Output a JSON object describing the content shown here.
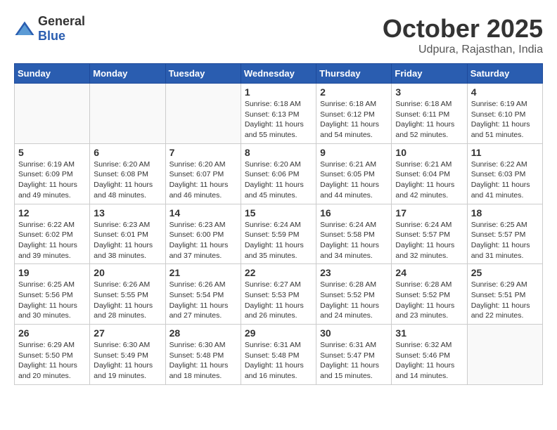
{
  "logo": {
    "general": "General",
    "blue": "Blue"
  },
  "title": "October 2025",
  "location": "Udpura, Rajasthan, India",
  "weekdays": [
    "Sunday",
    "Monday",
    "Tuesday",
    "Wednesday",
    "Thursday",
    "Friday",
    "Saturday"
  ],
  "weeks": [
    [
      {
        "day": "",
        "info": ""
      },
      {
        "day": "",
        "info": ""
      },
      {
        "day": "",
        "info": ""
      },
      {
        "day": "1",
        "info": "Sunrise: 6:18 AM\nSunset: 6:13 PM\nDaylight: 11 hours\nand 55 minutes."
      },
      {
        "day": "2",
        "info": "Sunrise: 6:18 AM\nSunset: 6:12 PM\nDaylight: 11 hours\nand 54 minutes."
      },
      {
        "day": "3",
        "info": "Sunrise: 6:18 AM\nSunset: 6:11 PM\nDaylight: 11 hours\nand 52 minutes."
      },
      {
        "day": "4",
        "info": "Sunrise: 6:19 AM\nSunset: 6:10 PM\nDaylight: 11 hours\nand 51 minutes."
      }
    ],
    [
      {
        "day": "5",
        "info": "Sunrise: 6:19 AM\nSunset: 6:09 PM\nDaylight: 11 hours\nand 49 minutes."
      },
      {
        "day": "6",
        "info": "Sunrise: 6:20 AM\nSunset: 6:08 PM\nDaylight: 11 hours\nand 48 minutes."
      },
      {
        "day": "7",
        "info": "Sunrise: 6:20 AM\nSunset: 6:07 PM\nDaylight: 11 hours\nand 46 minutes."
      },
      {
        "day": "8",
        "info": "Sunrise: 6:20 AM\nSunset: 6:06 PM\nDaylight: 11 hours\nand 45 minutes."
      },
      {
        "day": "9",
        "info": "Sunrise: 6:21 AM\nSunset: 6:05 PM\nDaylight: 11 hours\nand 44 minutes."
      },
      {
        "day": "10",
        "info": "Sunrise: 6:21 AM\nSunset: 6:04 PM\nDaylight: 11 hours\nand 42 minutes."
      },
      {
        "day": "11",
        "info": "Sunrise: 6:22 AM\nSunset: 6:03 PM\nDaylight: 11 hours\nand 41 minutes."
      }
    ],
    [
      {
        "day": "12",
        "info": "Sunrise: 6:22 AM\nSunset: 6:02 PM\nDaylight: 11 hours\nand 39 minutes."
      },
      {
        "day": "13",
        "info": "Sunrise: 6:23 AM\nSunset: 6:01 PM\nDaylight: 11 hours\nand 38 minutes."
      },
      {
        "day": "14",
        "info": "Sunrise: 6:23 AM\nSunset: 6:00 PM\nDaylight: 11 hours\nand 37 minutes."
      },
      {
        "day": "15",
        "info": "Sunrise: 6:24 AM\nSunset: 5:59 PM\nDaylight: 11 hours\nand 35 minutes."
      },
      {
        "day": "16",
        "info": "Sunrise: 6:24 AM\nSunset: 5:58 PM\nDaylight: 11 hours\nand 34 minutes."
      },
      {
        "day": "17",
        "info": "Sunrise: 6:24 AM\nSunset: 5:57 PM\nDaylight: 11 hours\nand 32 minutes."
      },
      {
        "day": "18",
        "info": "Sunrise: 6:25 AM\nSunset: 5:57 PM\nDaylight: 11 hours\nand 31 minutes."
      }
    ],
    [
      {
        "day": "19",
        "info": "Sunrise: 6:25 AM\nSunset: 5:56 PM\nDaylight: 11 hours\nand 30 minutes."
      },
      {
        "day": "20",
        "info": "Sunrise: 6:26 AM\nSunset: 5:55 PM\nDaylight: 11 hours\nand 28 minutes."
      },
      {
        "day": "21",
        "info": "Sunrise: 6:26 AM\nSunset: 5:54 PM\nDaylight: 11 hours\nand 27 minutes."
      },
      {
        "day": "22",
        "info": "Sunrise: 6:27 AM\nSunset: 5:53 PM\nDaylight: 11 hours\nand 26 minutes."
      },
      {
        "day": "23",
        "info": "Sunrise: 6:28 AM\nSunset: 5:52 PM\nDaylight: 11 hours\nand 24 minutes."
      },
      {
        "day": "24",
        "info": "Sunrise: 6:28 AM\nSunset: 5:52 PM\nDaylight: 11 hours\nand 23 minutes."
      },
      {
        "day": "25",
        "info": "Sunrise: 6:29 AM\nSunset: 5:51 PM\nDaylight: 11 hours\nand 22 minutes."
      }
    ],
    [
      {
        "day": "26",
        "info": "Sunrise: 6:29 AM\nSunset: 5:50 PM\nDaylight: 11 hours\nand 20 minutes."
      },
      {
        "day": "27",
        "info": "Sunrise: 6:30 AM\nSunset: 5:49 PM\nDaylight: 11 hours\nand 19 minutes."
      },
      {
        "day": "28",
        "info": "Sunrise: 6:30 AM\nSunset: 5:48 PM\nDaylight: 11 hours\nand 18 minutes."
      },
      {
        "day": "29",
        "info": "Sunrise: 6:31 AM\nSunset: 5:48 PM\nDaylight: 11 hours\nand 16 minutes."
      },
      {
        "day": "30",
        "info": "Sunrise: 6:31 AM\nSunset: 5:47 PM\nDaylight: 11 hours\nand 15 minutes."
      },
      {
        "day": "31",
        "info": "Sunrise: 6:32 AM\nSunset: 5:46 PM\nDaylight: 11 hours\nand 14 minutes."
      },
      {
        "day": "",
        "info": ""
      }
    ]
  ]
}
